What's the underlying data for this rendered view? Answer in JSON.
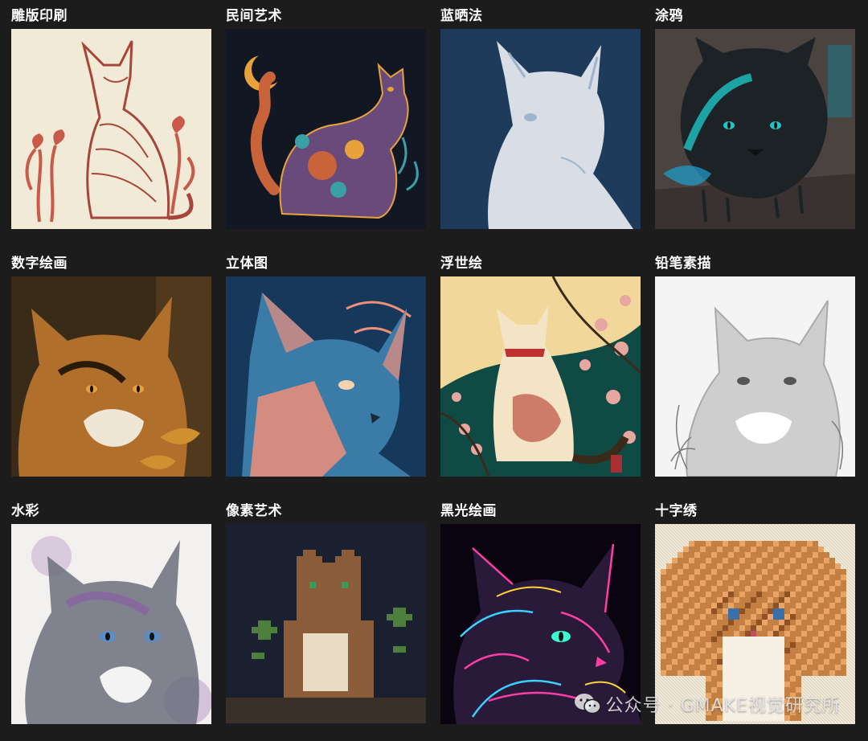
{
  "tiles": [
    {
      "label": "雕版印刷",
      "style": "woodblock",
      "bg": "#f1ead6",
      "fg": "#a8453a",
      "accent": "#c85a4a"
    },
    {
      "label": "民间艺术",
      "style": "folk-art",
      "bg": "#111824",
      "fg": "#c9643a",
      "accent": "#e8a23c"
    },
    {
      "label": "蓝晒法",
      "style": "cyanotype",
      "bg": "#1f3b5c",
      "fg": "#e8ecf2",
      "accent": "#9fb4cc"
    },
    {
      "label": "涂鸦",
      "style": "graffiti",
      "bg": "#4a4340",
      "fg": "#1d2227",
      "accent": "#1fc4c4"
    },
    {
      "label": "数字绘画",
      "style": "digital-painting",
      "bg": "#3a2a18",
      "fg": "#b0702c",
      "accent": "#e8a040"
    },
    {
      "label": "立体图",
      "style": "cubism",
      "bg": "#16385a",
      "fg": "#3a7ba8",
      "accent": "#f08f7a"
    },
    {
      "label": "浮世绘",
      "style": "ukiyo-e",
      "bg": "#0f4a45",
      "fg": "#f2e4c4",
      "accent": "#e7a7a0"
    },
    {
      "label": "铅笔素描",
      "style": "pencil-sketch",
      "bg": "#f4f4f4",
      "fg": "#7a7a7a",
      "accent": "#b5b5b5"
    },
    {
      "label": "水彩",
      "style": "watercolor",
      "bg": "#f3f1ef",
      "fg": "#6b6e7c",
      "accent": "#8a5aa8"
    },
    {
      "label": "像素艺术",
      "style": "pixel-art",
      "bg": "#1a2030",
      "fg": "#8a5c3a",
      "accent": "#4f7f3f"
    },
    {
      "label": "黑光绘画",
      "style": "blacklight",
      "bg": "#0a0410",
      "fg": "#2a1a3a",
      "accent": "#ff3ea5"
    },
    {
      "label": "十字绣",
      "style": "cross-stitch",
      "bg": "#ddd5cc",
      "fg": "#c07a3a",
      "accent": "#3a6fa8"
    }
  ],
  "watermark": {
    "text": "公众号 · GMAKE视觉研究所",
    "icon": "wechat-icon"
  }
}
